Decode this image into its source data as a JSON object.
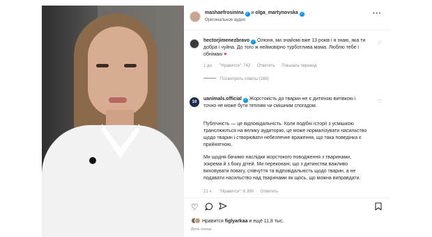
{
  "header": {
    "user1": "mashaefrosinina",
    "and_text": "и",
    "user2": "olga_martynovska",
    "subtitle": "Оригинальное аудио",
    "more_icon": "more-horizontal-icon"
  },
  "comments": [
    {
      "username": "hectorjimenezbravo",
      "text": "Олюня, ми знайомі вже 13 років і я знаю, яка ти добра і чуйна. До того ж неймовірно турботлива мама. Люблю тебе і обнімаю",
      "emoji": "♥",
      "time": "1 дн.",
      "likes": "\"Нравится\": 742",
      "reply": "Ответить",
      "translate": "Показать перевод",
      "replies_label": "Посмотреть ответы (188)"
    },
    {
      "username": "uanimals.official",
      "avatar_text": "10",
      "para1": "Жорстокість до тварин не є дитячою витівкою і точно не може бути теплим чи смішним спогадом.",
      "para2": "Публічність — це відповідальність. Коли подібні історії з усмішкою транслюються на велику аудиторію, це може нормалізувати насильство щодо тварин і створювати небезпечне враження, що така поведінка є прийнятною.",
      "para3": "Ми щодня бачимо наслідки жорстокого поводження з тваринами, зокрема й з боку дітей. Ми переконані, що з дитинства важливо виховувати повагу, співчуття та відповідальність щодо тварин, а не подавати насильство над тваринами як щось, що можна виправдати.",
      "time": "21 ч.",
      "likes": "\"Нравится\": 6 399",
      "reply": "Ответить"
    }
  ],
  "actions": {
    "like_icon": "heart-icon",
    "comment_icon": "comment-icon",
    "share_icon": "send-icon",
    "save_icon": "bookmark-icon",
    "likes_prefix": "Нравится",
    "likes_user": "figlyarkaa",
    "likes_suffix": "и ещё 11,8 тыс.",
    "date": "День назад"
  }
}
